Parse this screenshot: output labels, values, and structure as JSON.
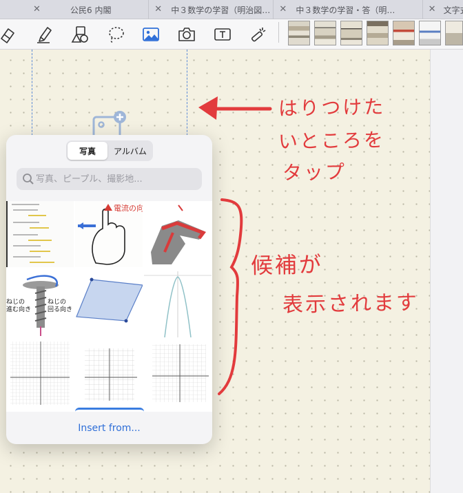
{
  "tabs": [
    {
      "label": "公民6 内閣"
    },
    {
      "label": "中３数学の学習（明治図…"
    },
    {
      "label": "中３数学の学習・答（明…"
    },
    {
      "label": "文字式で"
    }
  ],
  "toolbar": {
    "tools": [
      "eraser-icon",
      "highlighter-icon",
      "shapes-icon",
      "lasso-icon",
      "image-icon",
      "camera-icon",
      "text-box-icon",
      "laser-pointer-icon"
    ]
  },
  "popover": {
    "segment_photos": "写真",
    "segment_albums": "アルバム",
    "search_placeholder": "写真、ピープル、撮影地...",
    "insert_from": "Insert from...",
    "screw_label_left": "ねじの\n進む向き",
    "screw_label_right": "ねじの\n回る向き",
    "hand_label": "電流の向"
  },
  "annotations": {
    "tap_note": [
      "はりつけた",
      "いところを",
      "タップ"
    ],
    "candidate_note": [
      "候補が",
      "表示されます"
    ]
  },
  "colors": {
    "annotation": "#e23b3d",
    "accent": "#2f6fd8",
    "selection": "#5b8ad6"
  }
}
